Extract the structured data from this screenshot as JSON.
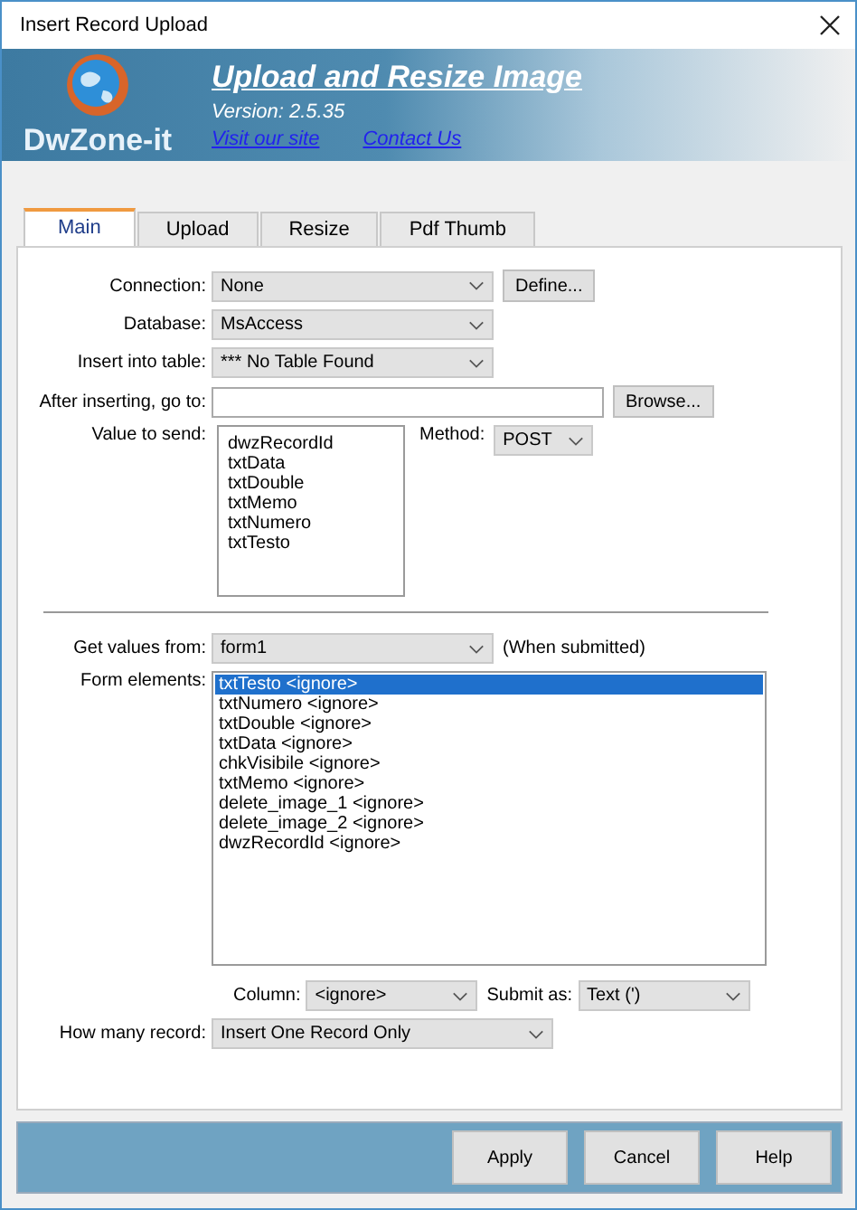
{
  "window": {
    "title": "Insert Record Upload"
  },
  "banner": {
    "logo_text": "DwZone-it",
    "title": "Upload and Resize Image",
    "version": "Version: 2.5.35",
    "links": [
      "Visit our site",
      "Contact Us"
    ]
  },
  "tabs": [
    {
      "label": "Main",
      "selected": true
    },
    {
      "label": "Upload",
      "selected": false
    },
    {
      "label": "Resize",
      "selected": false
    },
    {
      "label": "Pdf Thumb",
      "selected": false
    }
  ],
  "connection": {
    "label": "Connection:",
    "value": "None",
    "button": "Define..."
  },
  "database": {
    "label": "Database:",
    "value": "MsAccess"
  },
  "table": {
    "label": "Insert into table:",
    "value": "*** No Table Found"
  },
  "after_insert": {
    "label": "After inserting, go to:",
    "button": "Browse..."
  },
  "values": {
    "label": "Value to send:",
    "items": [
      "dwzRecordId",
      "txtData",
      "txtDouble",
      "txtMemo",
      "txtNumero",
      "txtTesto"
    ],
    "method_label": "Method:",
    "method": "POST"
  },
  "get_values": {
    "label": "Get values from:",
    "value": "form1",
    "note": "(When submitted)"
  },
  "form_elements": {
    "label": "Form elements:",
    "items": [
      {
        "text": "txtTesto <ignore>",
        "selected": true
      },
      {
        "text": "txtNumero <ignore>",
        "selected": false
      },
      {
        "text": "txtDouble <ignore>",
        "selected": false
      },
      {
        "text": "txtData <ignore>",
        "selected": false
      },
      {
        "text": "chkVisibile <ignore>",
        "selected": false
      },
      {
        "text": "txtMemo <ignore>",
        "selected": false
      },
      {
        "text": "delete_image_1 <ignore>",
        "selected": false
      },
      {
        "text": "delete_image_2 <ignore>",
        "selected": false
      },
      {
        "text": "dwzRecordId <ignore>",
        "selected": false
      }
    ]
  },
  "column": {
    "label": "Column:",
    "value": "<ignore>",
    "submit_label": "Submit as:",
    "submit_value": "Text (')"
  },
  "records": {
    "label": "How many record:",
    "value": "Insert One Record Only"
  },
  "buttons": [
    "Apply",
    "Cancel",
    "Help"
  ]
}
